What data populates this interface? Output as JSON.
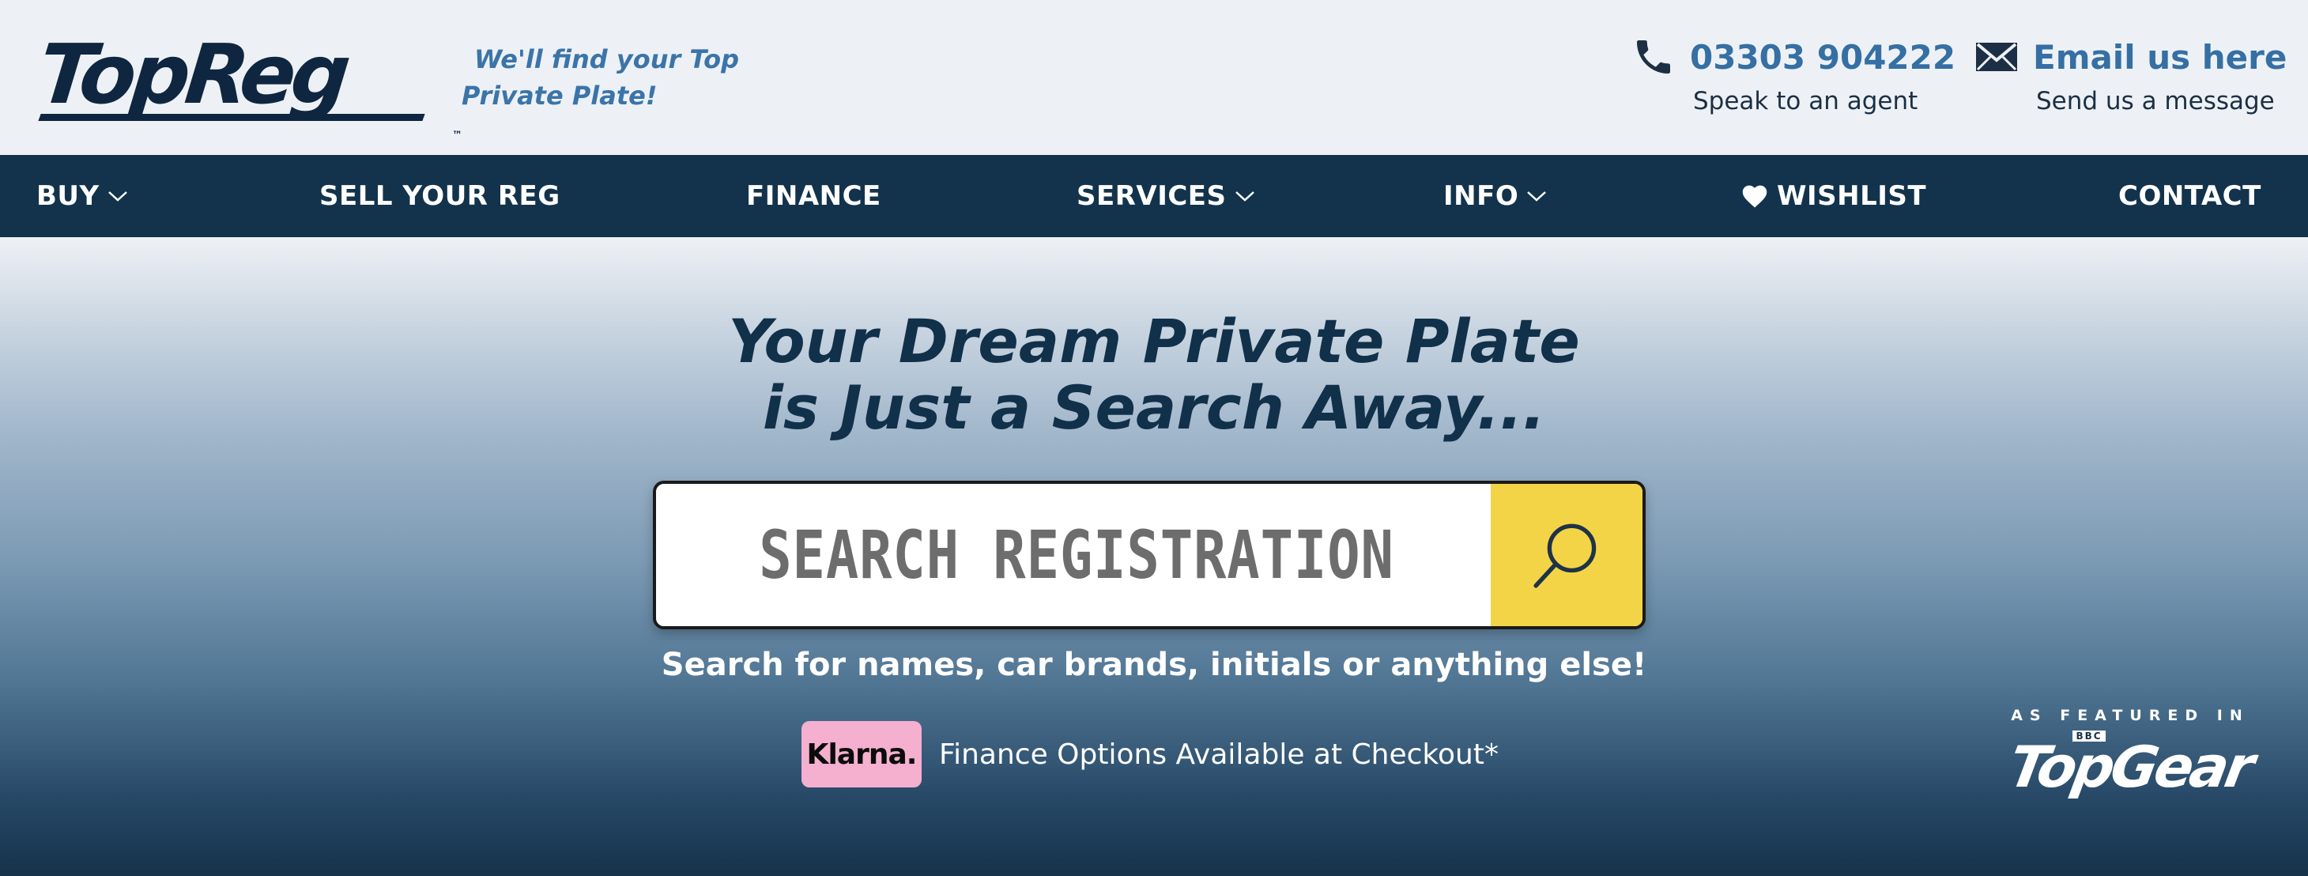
{
  "header": {
    "logo_text": "TopReg",
    "logo_tm": "™",
    "tagline_line1": "We'll find your Top",
    "tagline_line2": "Private Plate!",
    "phone": {
      "number": "03303 904222",
      "sub": "Speak to an agent",
      "icon": "phone-icon"
    },
    "email": {
      "label": "Email us here",
      "sub": "Send us a message",
      "icon": "envelope-icon"
    }
  },
  "nav": {
    "items": [
      {
        "label": "BUY",
        "has_dropdown": true
      },
      {
        "label": "SELL YOUR REG",
        "has_dropdown": false
      },
      {
        "label": "FINANCE",
        "has_dropdown": false
      },
      {
        "label": "SERVICES",
        "has_dropdown": true
      },
      {
        "label": "INFO",
        "has_dropdown": true
      },
      {
        "label": "WISHLIST",
        "icon": "heart-icon"
      },
      {
        "label": "CONTACT",
        "has_dropdown": false
      }
    ]
  },
  "hero": {
    "title_line1": "Your Dream Private Plate",
    "title_line2": "is Just a Search Away...",
    "search_placeholder": "SEARCH REGISTRATION",
    "search_button_icon": "search-icon",
    "hint": "Search for names, car brands, initials or anything else!",
    "klarna_badge": "Klarna.",
    "klarna_text": "Finance Options Available at Checkout*",
    "featured_label": "AS FEATURED IN",
    "featured_bbc": "BBC",
    "featured_logo": "TopGear"
  },
  "colors": {
    "navy": "#12334b",
    "accent_blue": "#356fa3",
    "search_yellow": "#f3d447",
    "klarna_pink": "#f5afcf"
  }
}
